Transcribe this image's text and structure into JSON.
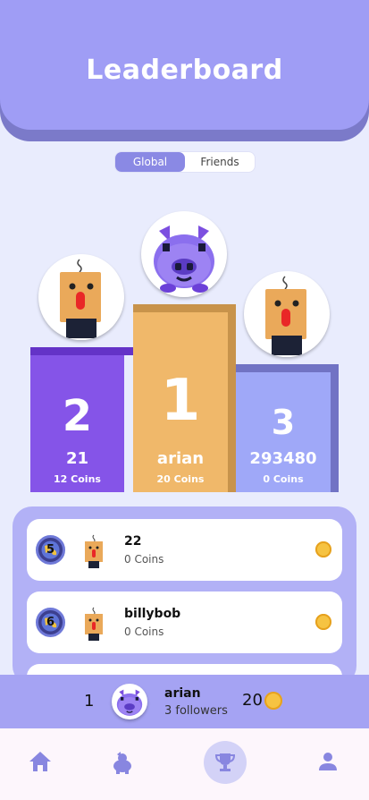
{
  "header": {
    "title": "Leaderboard"
  },
  "toggle": {
    "global_label": "Global",
    "friends_label": "Friends",
    "selected": "Global"
  },
  "colors": {
    "header": "#9f9df5",
    "first_place": "#f0b86a",
    "second_place": "#8554e8",
    "third_place": "#9fa8f8",
    "coin": "#f6c342"
  },
  "podium": {
    "first": {
      "rank": "1",
      "name": "arian",
      "coins": "20 Coins",
      "avatar": "purple-pig-avatar"
    },
    "second": {
      "rank": "2",
      "name": "21",
      "coins": "12 Coins",
      "avatar": "orange-box-avatar"
    },
    "third": {
      "rank": "3",
      "name": "293480",
      "coins": "0 Coins",
      "avatar": "orange-box-avatar"
    }
  },
  "list": [
    {
      "rank": "5",
      "name": "22",
      "coins": "0 Coins",
      "avatar": "orange-box-avatar"
    },
    {
      "rank": "6",
      "name": "billybob",
      "coins": "0 Coins",
      "avatar": "orange-box-avatar"
    }
  ],
  "me": {
    "rank": "1",
    "name": "arian",
    "followers": "3 followers",
    "coins": "20",
    "avatar": "purple-pig-avatar"
  },
  "nav": {
    "items": [
      "home-icon",
      "pig-icon",
      "trophy-icon",
      "profile-icon"
    ],
    "active": "trophy-icon"
  }
}
